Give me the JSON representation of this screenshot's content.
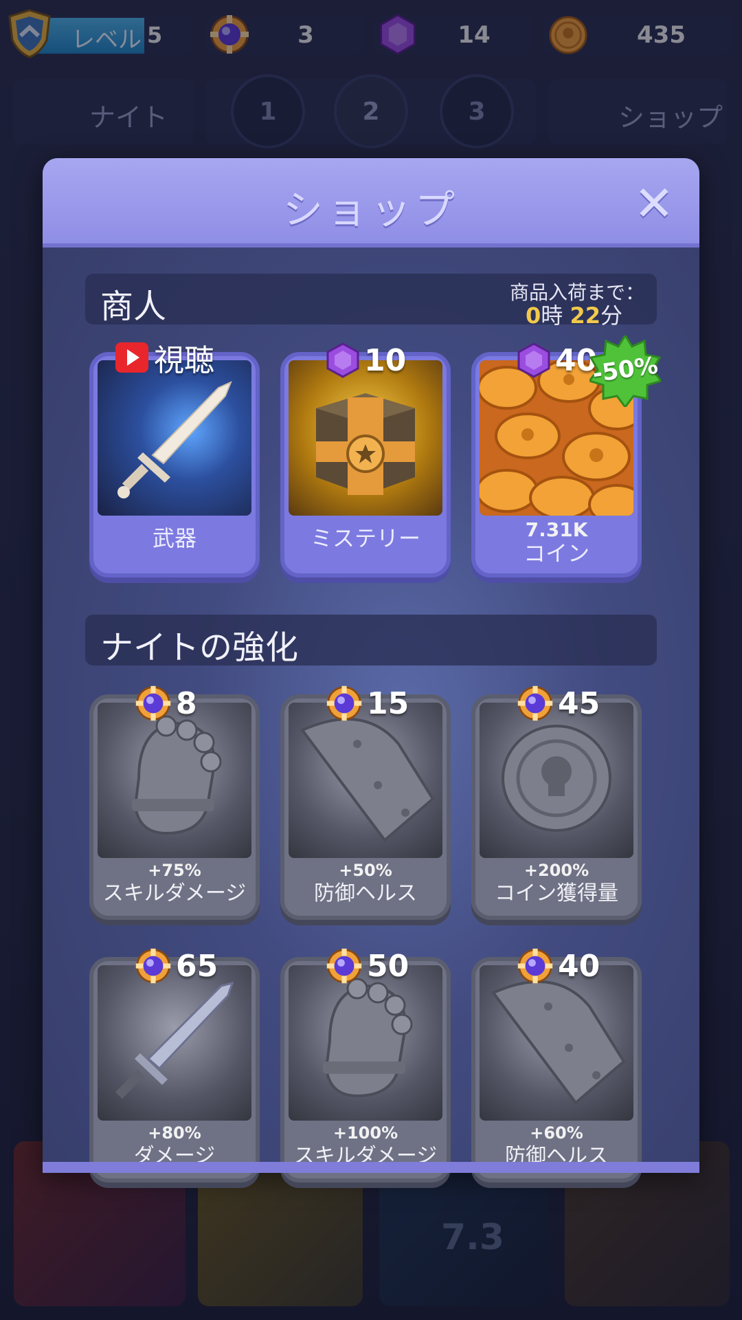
{
  "hud": {
    "level_label": "レベル",
    "level_value": "5",
    "orb_count": "3",
    "gem_count": "14",
    "coin_count": "435"
  },
  "nav": {
    "knight_label": "ナイト",
    "stages": [
      "1",
      "2",
      "3"
    ],
    "shop_label": "ショップ"
  },
  "background": {
    "bottom_value": "7.3"
  },
  "modal": {
    "title": "ショップ",
    "close_glyph": "✕"
  },
  "merchant": {
    "title": "商人",
    "restock_label": "商品入荷まで：",
    "restock_hours": "0",
    "restock_hours_unit": "時",
    "restock_minutes": "22",
    "restock_minutes_unit": "分",
    "items": [
      {
        "price_type": "video",
        "price_label": "視聴",
        "name": "武器",
        "icon": "sword-icon"
      },
      {
        "price_type": "gem",
        "price": "10",
        "name": "ミステリー",
        "icon": "chest-icon"
      },
      {
        "price_type": "gem",
        "price": "40",
        "amount": "7.31K",
        "name": "コイン",
        "badge": "-50%",
        "icon": "coins-icon"
      }
    ]
  },
  "upgrades": {
    "title": "ナイトの強化",
    "items": [
      {
        "price": "8",
        "bonus": "+75%",
        "name": "スキルダメージ",
        "icon": "gauntlet-icon"
      },
      {
        "price": "15",
        "bonus": "+50%",
        "name": "防御ヘルス",
        "icon": "shield-plate-icon"
      },
      {
        "price": "45",
        "bonus": "+200%",
        "name": "コイン獲得量",
        "icon": "skull-coin-icon"
      },
      {
        "price": "65",
        "bonus": "+80%",
        "name": "ダメージ",
        "icon": "sword-icon"
      },
      {
        "price": "50",
        "bonus": "+100%",
        "name": "スキルダメージ",
        "icon": "gauntlet-icon"
      },
      {
        "price": "40",
        "bonus": "+60%",
        "name": "防御ヘルス",
        "icon": "shield-plate-icon"
      }
    ]
  },
  "colors": {
    "accent": "#8f8ee6",
    "gem": "#9b4de0",
    "coin": "#f0a13a",
    "badge": "#4fc23a",
    "time_highlight": "#f2c94c"
  }
}
